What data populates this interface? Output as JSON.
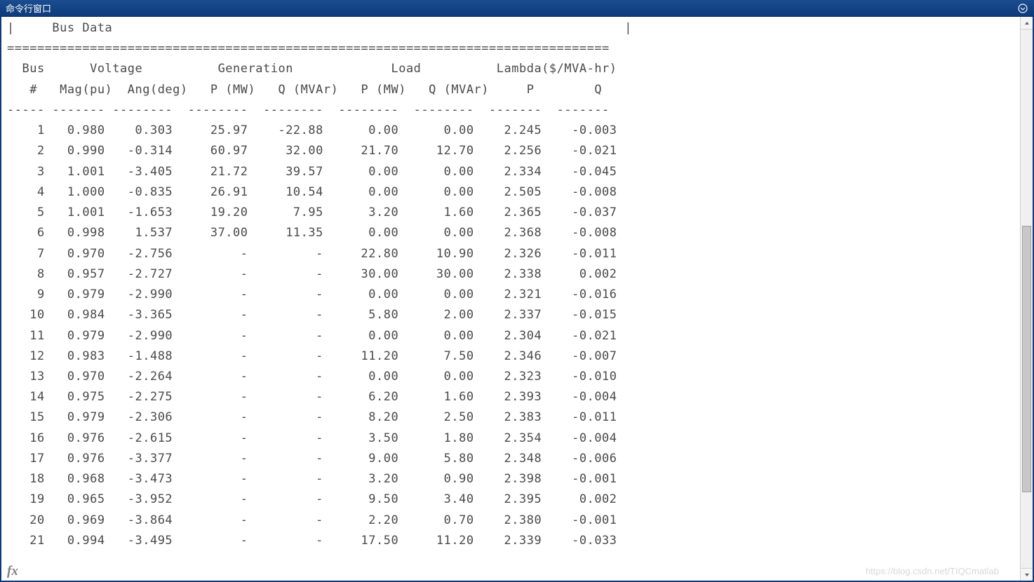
{
  "window": {
    "title": "命令行窗口"
  },
  "fx_label": "fx",
  "watermark": "https://blog.csdn.net/TIQCmatlab",
  "output": {
    "section_title": "Bus Data",
    "border_top": "================================================================================",
    "headers": {
      "group1": "  Bus      Voltage          Generation             Load          Lambda($/MVA-hr)",
      "group2": "   #   Mag(pu)  Ang(deg)   P (MW)   Q (MVAr)   P (MW)   Q (MVAr)     P        Q   "
    },
    "separator": "----- ------- --------  --------  --------  --------  --------  -------  -------",
    "rows": [
      {
        "bus": "1",
        "mag": "0.980",
        "ang": "0.303",
        "gp": "25.97",
        "gq": "-22.88",
        "lp": "0.00",
        "lq": "0.00",
        "lamp": "2.245",
        "lamq": "-0.003"
      },
      {
        "bus": "2",
        "mag": "0.990",
        "ang": "-0.314",
        "gp": "60.97",
        "gq": "32.00",
        "lp": "21.70",
        "lq": "12.70",
        "lamp": "2.256",
        "lamq": "-0.021"
      },
      {
        "bus": "3",
        "mag": "1.001",
        "ang": "-3.405",
        "gp": "21.72",
        "gq": "39.57",
        "lp": "0.00",
        "lq": "0.00",
        "lamp": "2.334",
        "lamq": "-0.045"
      },
      {
        "bus": "4",
        "mag": "1.000",
        "ang": "-0.835",
        "gp": "26.91",
        "gq": "10.54",
        "lp": "0.00",
        "lq": "0.00",
        "lamp": "2.505",
        "lamq": "-0.008"
      },
      {
        "bus": "5",
        "mag": "1.001",
        "ang": "-1.653",
        "gp": "19.20",
        "gq": "7.95",
        "lp": "3.20",
        "lq": "1.60",
        "lamp": "2.365",
        "lamq": "-0.037"
      },
      {
        "bus": "6",
        "mag": "0.998",
        "ang": "1.537",
        "gp": "37.00",
        "gq": "11.35",
        "lp": "0.00",
        "lq": "0.00",
        "lamp": "2.368",
        "lamq": "-0.008"
      },
      {
        "bus": "7",
        "mag": "0.970",
        "ang": "-2.756",
        "gp": "-",
        "gq": "-",
        "lp": "22.80",
        "lq": "10.90",
        "lamp": "2.326",
        "lamq": "-0.011"
      },
      {
        "bus": "8",
        "mag": "0.957",
        "ang": "-2.727",
        "gp": "-",
        "gq": "-",
        "lp": "30.00",
        "lq": "30.00",
        "lamp": "2.338",
        "lamq": "0.002"
      },
      {
        "bus": "9",
        "mag": "0.979",
        "ang": "-2.990",
        "gp": "-",
        "gq": "-",
        "lp": "0.00",
        "lq": "0.00",
        "lamp": "2.321",
        "lamq": "-0.016"
      },
      {
        "bus": "10",
        "mag": "0.984",
        "ang": "-3.365",
        "gp": "-",
        "gq": "-",
        "lp": "5.80",
        "lq": "2.00",
        "lamp": "2.337",
        "lamq": "-0.015"
      },
      {
        "bus": "11",
        "mag": "0.979",
        "ang": "-2.990",
        "gp": "-",
        "gq": "-",
        "lp": "0.00",
        "lq": "0.00",
        "lamp": "2.304",
        "lamq": "-0.021"
      },
      {
        "bus": "12",
        "mag": "0.983",
        "ang": "-1.488",
        "gp": "-",
        "gq": "-",
        "lp": "11.20",
        "lq": "7.50",
        "lamp": "2.346",
        "lamq": "-0.007"
      },
      {
        "bus": "13",
        "mag": "0.970",
        "ang": "-2.264",
        "gp": "-",
        "gq": "-",
        "lp": "0.00",
        "lq": "0.00",
        "lamp": "2.323",
        "lamq": "-0.010"
      },
      {
        "bus": "14",
        "mag": "0.975",
        "ang": "-2.275",
        "gp": "-",
        "gq": "-",
        "lp": "6.20",
        "lq": "1.60",
        "lamp": "2.393",
        "lamq": "-0.004"
      },
      {
        "bus": "15",
        "mag": "0.979",
        "ang": "-2.306",
        "gp": "-",
        "gq": "-",
        "lp": "8.20",
        "lq": "2.50",
        "lamp": "2.383",
        "lamq": "-0.011"
      },
      {
        "bus": "16",
        "mag": "0.976",
        "ang": "-2.615",
        "gp": "-",
        "gq": "-",
        "lp": "3.50",
        "lq": "1.80",
        "lamp": "2.354",
        "lamq": "-0.004"
      },
      {
        "bus": "17",
        "mag": "0.976",
        "ang": "-3.377",
        "gp": "-",
        "gq": "-",
        "lp": "9.00",
        "lq": "5.80",
        "lamp": "2.348",
        "lamq": "-0.006"
      },
      {
        "bus": "18",
        "mag": "0.968",
        "ang": "-3.473",
        "gp": "-",
        "gq": "-",
        "lp": "3.20",
        "lq": "0.90",
        "lamp": "2.398",
        "lamq": "-0.001"
      },
      {
        "bus": "19",
        "mag": "0.965",
        "ang": "-3.952",
        "gp": "-",
        "gq": "-",
        "lp": "9.50",
        "lq": "3.40",
        "lamp": "2.395",
        "lamq": "0.002"
      },
      {
        "bus": "20",
        "mag": "0.969",
        "ang": "-3.864",
        "gp": "-",
        "gq": "-",
        "lp": "2.20",
        "lq": "0.70",
        "lamp": "2.380",
        "lamq": "-0.001"
      },
      {
        "bus": "21",
        "mag": "0.994",
        "ang": "-3.495",
        "gp": "-",
        "gq": "-",
        "lp": "17.50",
        "lq": "11.20",
        "lamp": "2.339",
        "lamq": "-0.033"
      }
    ]
  }
}
